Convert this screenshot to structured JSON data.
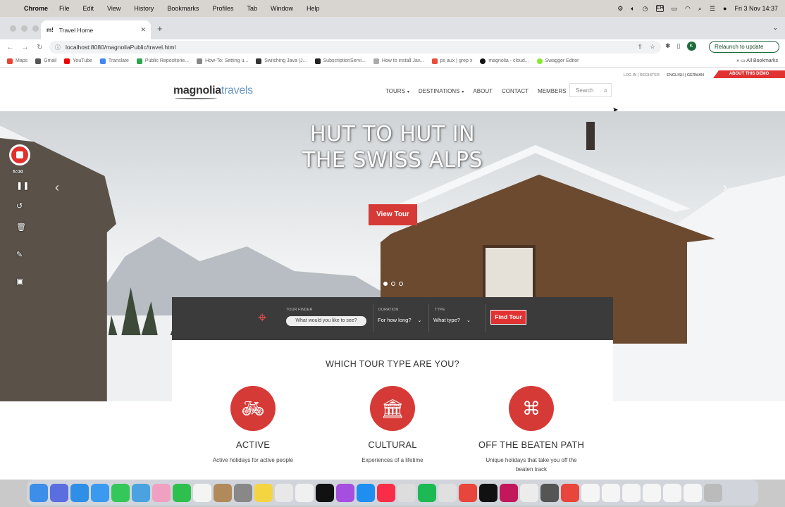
{
  "menubar": {
    "app": "Chrome",
    "items": [
      "File",
      "Edit",
      "View",
      "History",
      "Bookmarks",
      "Profiles",
      "Tab",
      "Window",
      "Help"
    ],
    "status": {
      "keyboard": "CH",
      "datetime": "Fri 3 Nov 14:37"
    }
  },
  "browser": {
    "tab_title": "Travel Home",
    "tab_favicon": "m!",
    "url": "localhost:8080/magnoliaPublic/travel.html",
    "profile_initial": "K",
    "relaunch_label": "Relaunch to update",
    "bookmarks": [
      "Maps",
      "Gmail",
      "YouTube",
      "Translate",
      "Public Repositorie...",
      "How-To: Setting u...",
      "Switching Java (J...",
      "SubscriptionServi...",
      "How to install Jav...",
      "ps aux | grep x",
      "magnolia - cloud...",
      "Swagger Editor"
    ],
    "all_bookmarks": "All Bookmarks"
  },
  "site": {
    "topbar": {
      "login": "LOG IN | REGISTER",
      "lang": "ENGLISH | GERMAN",
      "about": "ABOUT THIS DEMO"
    },
    "logo": {
      "part1": "magnolia",
      "part2": "travels"
    },
    "nav": [
      "TOURS",
      "DESTINATIONS",
      "ABOUT",
      "CONTACT",
      "MEMBERS"
    ],
    "search_placeholder": "Search",
    "hero": {
      "line1": "HUT TO HUT IN",
      "line2": "THE SWISS ALPS",
      "cta": "View Tour"
    },
    "finder": {
      "tour_label": "TOUR FINDER",
      "tour_placeholder": "What would you like to see?",
      "duration_label": "DURATION",
      "duration_value": "For how long?",
      "type_label": "TYPE",
      "type_value": "What type?",
      "button": "Find Tour"
    },
    "tour_types": {
      "heading": "WHICH TOUR TYPE ARE YOU?",
      "items": [
        {
          "name": "ACTIVE",
          "desc": "Active holidays for active people",
          "icon": "bicycle-icon"
        },
        {
          "name": "CULTURAL",
          "desc": "Experiences of a lifetime",
          "icon": "museum-icon"
        },
        {
          "name": "OFF THE BEATEN PATH",
          "desc": "Unique holidays that take you off the beaten track",
          "icon": "binoculars-icon"
        }
      ]
    }
  },
  "recorder": {
    "time": "5:00"
  },
  "colors": {
    "brand_red": "#d63a36",
    "finder_bg": "#3b3b3b",
    "logo_blue": "#6a98c2"
  }
}
